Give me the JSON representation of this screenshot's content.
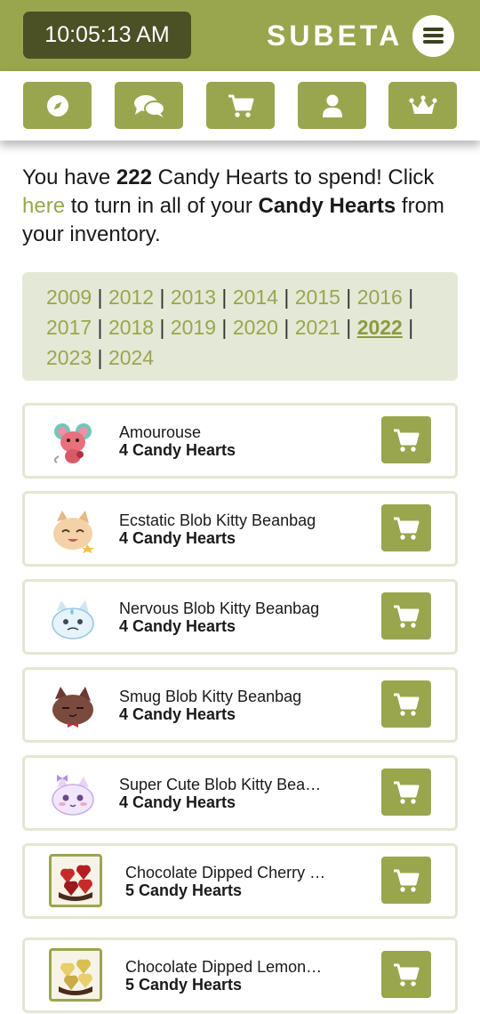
{
  "header": {
    "clock": "10:05:13 AM",
    "brand": "SUBETA",
    "menu_icon": "hamburger-icon"
  },
  "nav": {
    "buttons": [
      {
        "icon": "compass-icon"
      },
      {
        "icon": "chat-bubbles-icon"
      },
      {
        "icon": "shopping-cart-icon"
      },
      {
        "icon": "user-icon"
      },
      {
        "icon": "crown-icon"
      }
    ]
  },
  "intro": {
    "prefix": "You have ",
    "count": "222",
    "middle": " Candy Hearts to spend! Click ",
    "link": "here",
    "after_link": " to turn in all of your ",
    "bold_phrase": "Candy Hearts",
    "suffix": " from your inventory."
  },
  "years": [
    "2009",
    "2012",
    "2013",
    "2014",
    "2015",
    "2016",
    "2017",
    "2018",
    "2019",
    "2020",
    "2021",
    "2022",
    "2023",
    "2024"
  ],
  "years_current": "2022",
  "items": [
    {
      "name": "Amourouse",
      "price": "4 Candy Hearts"
    },
    {
      "name": "Ecstatic Blob Kitty Beanbag",
      "price": "4 Candy Hearts"
    },
    {
      "name": "Nervous Blob Kitty Beanbag",
      "price": "4 Candy Hearts"
    },
    {
      "name": "Smug Blob Kitty Beanbag",
      "price": "4 Candy Hearts"
    },
    {
      "name": "Super Cute Blob Kitty Bea…",
      "price": "4 Candy Hearts"
    },
    {
      "name": "Chocolate Dipped Cherry …",
      "price": "5 Candy Hearts"
    },
    {
      "name": "Chocolate Dipped Lemon…",
      "price": "5 Candy Hearts"
    }
  ],
  "colors": {
    "accent": "#9aa64e",
    "clock_bg": "#4b5025",
    "year_panel_bg": "#e4e8d6",
    "card_border": "#e3e7d4"
  }
}
